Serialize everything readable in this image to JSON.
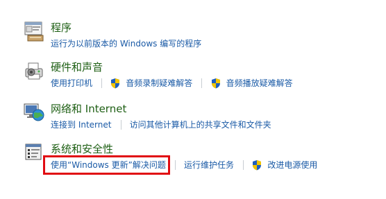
{
  "categories": [
    {
      "title": "程序",
      "icon": "programs-icon",
      "links": [
        {
          "label": "运行为以前版本的 Windows 编写的程序",
          "shield": false
        }
      ]
    },
    {
      "title": "硬件和声音",
      "icon": "printer-icon",
      "links": [
        {
          "label": "使用打印机",
          "shield": false
        },
        {
          "label": "音频录制疑难解答",
          "shield": true
        },
        {
          "label": "音频播放疑难解答",
          "shield": true
        }
      ]
    },
    {
      "title": "网络和 Internet",
      "icon": "network-globe-icon",
      "links": [
        {
          "label": "连接到 Internet",
          "shield": false
        },
        {
          "label": "访问其他计算机上的共享文件和文件夹",
          "shield": false
        }
      ]
    },
    {
      "title": "系统和安全性",
      "icon": "system-security-icon",
      "links": [
        {
          "label": "使用“Windows 更新”解决问题",
          "shield": false
        },
        {
          "label": "运行维护任务",
          "shield": false
        },
        {
          "label": "改进电源使用",
          "shield": true
        }
      ]
    }
  ],
  "colors": {
    "title": "#1e5f14",
    "link": "#1a5aa6",
    "separator": "#c8cdd2",
    "highlight": "#e10b12",
    "shield_blue": "#1f5fbf",
    "shield_yellow": "#f2c400"
  }
}
